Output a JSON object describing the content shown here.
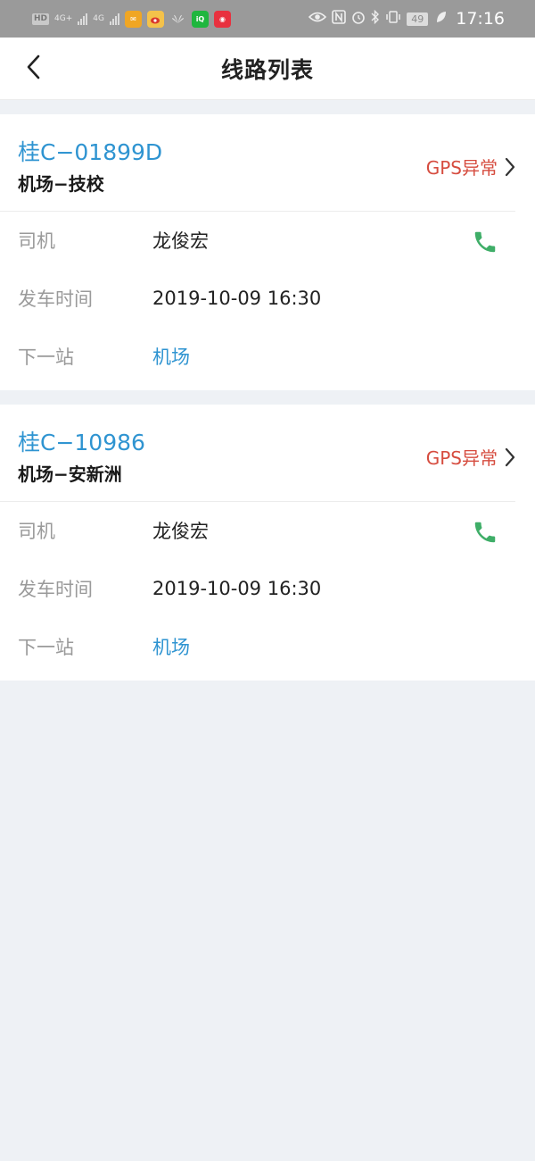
{
  "status_bar": {
    "hd_label": "HD",
    "net1_label": "4G+",
    "net2_label": "4G",
    "app_icons": [
      "mail-app-icon",
      "weibo-app-icon",
      "huawei-app-icon",
      "iqiyi-app-icon",
      "app-icon"
    ],
    "battery": "49",
    "time": "17:16"
  },
  "header": {
    "title": "线路列表",
    "back_icon": "chevron-left-icon"
  },
  "routes": [
    {
      "plate": "桂C−01899D",
      "route": "机场−技校",
      "gps_status": "GPS异常",
      "driver_label": "司机",
      "driver": "龙俊宏",
      "depart_label": "发车时间",
      "depart_time": "2019-10-09 16:30",
      "next_label": "下一站",
      "next_stop": "机场"
    },
    {
      "plate": "桂C−10986",
      "route": "机场−安新洲",
      "gps_status": "GPS异常",
      "driver_label": "司机",
      "driver": "龙俊宏",
      "depart_label": "发车时间",
      "depart_time": "2019-10-09 16:30",
      "next_label": "下一站",
      "next_stop": "机场"
    }
  ],
  "colors": {
    "accent_blue": "#2f94d1",
    "gps_red": "#d64c3f",
    "phone_green": "#3fae68",
    "background": "#eef1f5"
  }
}
